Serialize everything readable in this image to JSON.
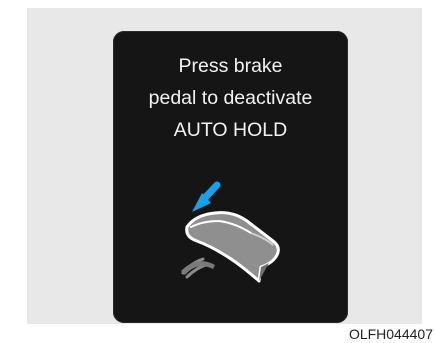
{
  "display": {
    "message_lines": [
      "Press brake",
      "pedal to deactivate",
      "AUTO HOLD"
    ],
    "icon": "foot-on-brake-pedal-icon",
    "arrow_color": "#1aa0e6"
  },
  "caption": "OLFH044407"
}
